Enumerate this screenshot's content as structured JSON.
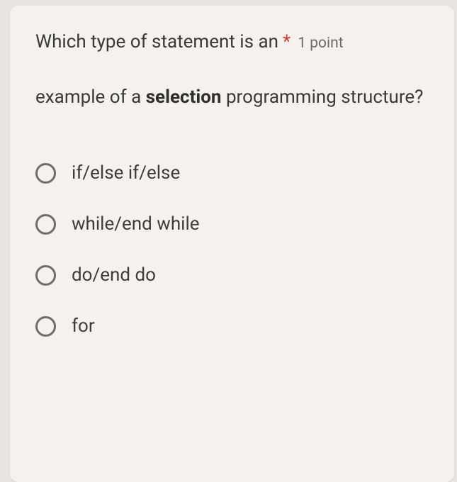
{
  "question": {
    "text_part1": "Which type of statement is an",
    "text_part2": "example of a ",
    "bold_word": "selection",
    "text_part3": " programming structure?",
    "required_marker": "*",
    "points_label": "1 point"
  },
  "options": [
    {
      "label": "if/else if/else"
    },
    {
      "label": "while/end while"
    },
    {
      "label": "do/end do"
    },
    {
      "label": "for"
    }
  ]
}
